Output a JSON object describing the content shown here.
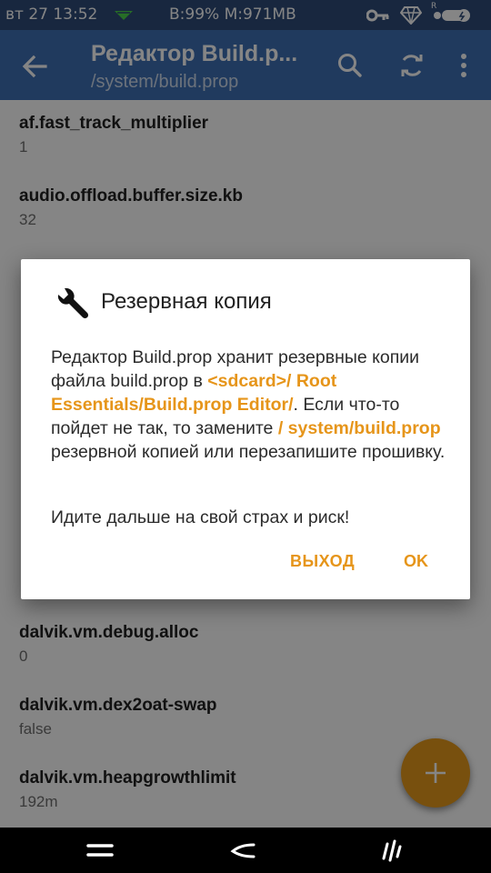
{
  "status_bar": {
    "time": "вт 27 13:52",
    "center": "B:99% M:971MB",
    "r_label": "R",
    "icons": [
      "signal-icon",
      "key-icon",
      "diamond-icon",
      "battery-icon"
    ]
  },
  "app_bar": {
    "title": "Редактор Build.p...",
    "subtitle": "/system/build.prop",
    "icons": [
      "back-arrow-icon",
      "search-icon",
      "refresh-icon",
      "more-vert-icon"
    ]
  },
  "props": [
    {
      "key": "af.fast_track_multiplier",
      "value": "1"
    },
    {
      "key": "audio.offload.buffer.size.kb",
      "value": "32"
    },
    {
      "key": "dalvik.vm.debug.alloc",
      "value": "0"
    },
    {
      "key": "dalvik.vm.dex2oat-swap",
      "value": "false"
    },
    {
      "key": "dalvik.vm.heapgrowthlimit",
      "value": "192m"
    }
  ],
  "dialog": {
    "title": "Резервная копия",
    "icon": "wrench-icon",
    "body": {
      "p1": "Редактор Build.prop хранит резервные копии файла build.prop в ",
      "h1": "<sdcard>/ Root Essentials/Build.prop Editor/",
      "p2": ". Если что-то пойдет не так, то замените ",
      "h2": "/ system/build.prop",
      "p3": " резервной копией или перезапишите прошивку."
    },
    "note": "Идите дальше на свой страх и риск!",
    "buttons": {
      "exit": "ВЫХОД",
      "ok": "OK"
    }
  },
  "fab": {
    "icon": "plus-icon"
  },
  "nav_bar": {
    "icons": [
      "home-icon",
      "back-icon",
      "recents-icon"
    ]
  },
  "colors": {
    "status_bar": "#2e4b7a",
    "app_bar": "#3e6fb5",
    "accent": "#e69a1c"
  }
}
